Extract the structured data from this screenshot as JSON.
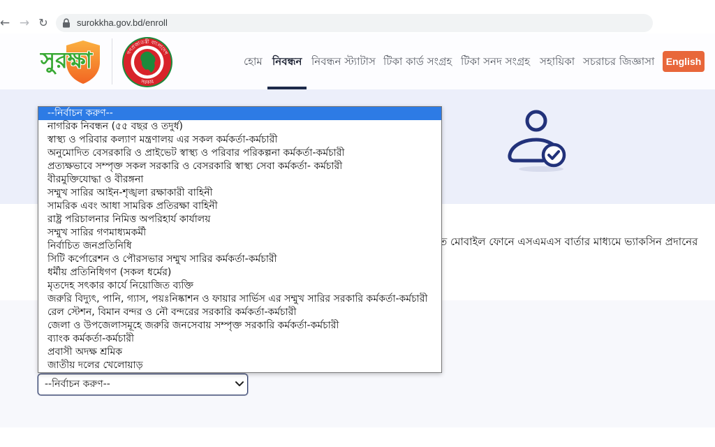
{
  "browser": {
    "url": "surokkha.gov.bd/enroll",
    "icons": {
      "back": "back-arrow-icon",
      "forward": "forward-arrow-icon",
      "reload": "reload-icon",
      "lock": "lock-icon"
    }
  },
  "header": {
    "logo_text": "সুরক্ষা",
    "seal_text_top": "গণপ্রজাতন্ত্রী বাংলাদেশ",
    "seal_text_bottom": "সরকার",
    "nav": [
      {
        "label": "হোম",
        "active": false
      },
      {
        "label": "নিবন্ধন",
        "active": true
      },
      {
        "label": "নিবন্ধন স্ট্যাটাস",
        "active": false
      },
      {
        "label": "টিকা কার্ড সংগ্রহ",
        "active": false
      },
      {
        "label": "টিকা সনদ সংগ্রহ",
        "active": false
      },
      {
        "label": "সহায়িকা",
        "active": false
      },
      {
        "label": "সচরাচর জিজ্ঞাসা",
        "active": false
      }
    ],
    "language_button": "English"
  },
  "hero": {
    "icon": "user-check-icon"
  },
  "intro": {
    "text": "ত মোবাইল ফোনে এসএমএস বার্তার মাধ্যমে ভ্যাকসিন প্রদানের"
  },
  "category_select": {
    "selected": "--নির্বাচন করুণ--",
    "expanded": true,
    "highlighted_index": 0,
    "chevron_icon": "chevron-down-icon",
    "options": [
      "--নির্বাচন করুণ--",
      "নাগরিক নিবন্ধন (৫৫ বছর ও তদুর্ধ)",
      "স্বাস্থ্য ও পরিবার কল্যাণ মন্ত্রণালয় এর সকল কর্মকর্তা-কর্মচারী",
      "অনুমোদিত বেসরকারি ও প্রাইভেট স্বাস্থ্য ও পরিবার পরিকল্পনা কর্মকর্তা-কর্মচারী",
      "প্রত্যক্ষভাবে সম্পৃক্ত সকল সরকারি ও বেসরকারি স্বাস্থ্য সেবা কর্মকর্তা- কর্মচারী",
      "বীরমুক্তিযোদ্ধা ও বীরঙ্গনা",
      "সম্মুখ সারির আইন-শৃঙ্খলা রক্ষাকারী বাহিনী",
      "সামরিক এবং আধা সামরিক প্রতিরক্ষা বাহিনী",
      "রাষ্ট্র পরিচালনার নিমিত্ত অপরিহার্য কার্যালয়",
      "সম্মুখ সারির গণমাধ্যমকর্মী",
      "নির্বাচিত জনপ্রতিনিধি",
      "সিটি কর্পোরেশন ও পৌরসভার সম্মুখ সারির কর্মকর্তা-কর্মচারী",
      "ধর্মীয় প্রতিনিধিগণ (সকল ধর্মের)",
      "মৃতদেহ সৎকার কার্যে নিয়োজিত ব্যক্তি",
      "জরুরি বিদ্যুৎ, পানি, গ্যাস, পয়ঃনিষ্কাশন ও ফায়ার সার্ভিস এর সম্মুখ সারির সরকারি কর্মকর্তা-কর্মচারী",
      "রেল স্টেশন, বিমান বন্দর ও নৌ বন্দরের সরকারি কর্মকর্তা-কর্মচারী",
      "জেলা ও উপজেলাসমূহে জরুরি জনসেবায় সম্পৃক্ত সরকারি কর্মকর্তা-কর্মচারী",
      "ব্যাংক কর্মকর্তা-কর্মচারী",
      "প্রবাসী অদক্ষ শ্রমিক",
      "জাতীয় দলের খেলোয়াড়"
    ]
  },
  "colors": {
    "accent": "#e8673a",
    "navy": "#22327a",
    "option_highlight": "#2d7be5",
    "logo_green": "#39a935",
    "logo_orange": "#f26522",
    "hero_band": "#eceffa"
  }
}
